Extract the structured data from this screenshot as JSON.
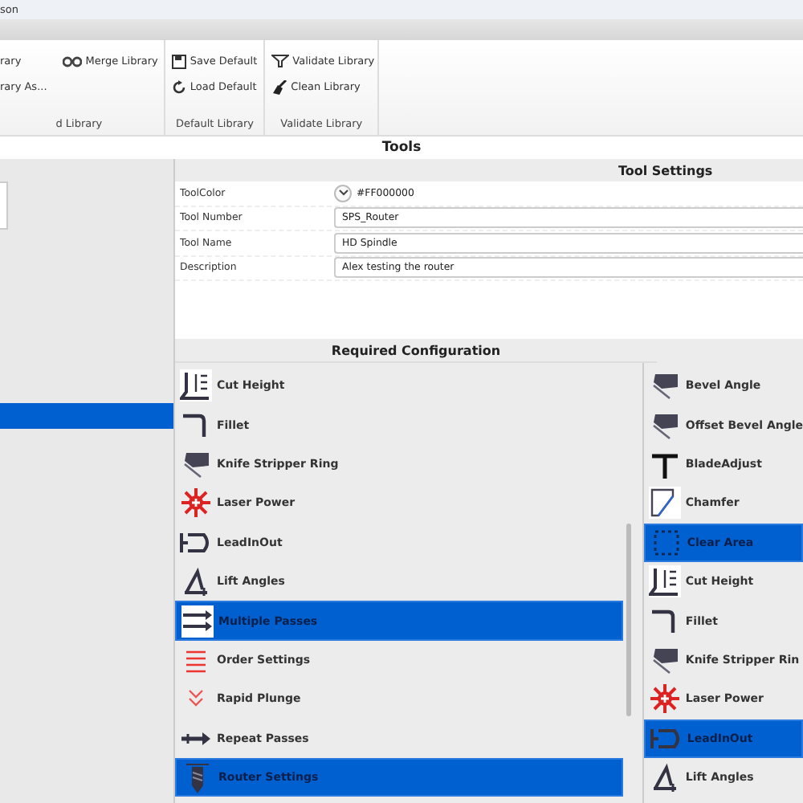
{
  "window": {
    "title": "son"
  },
  "ribbon": {
    "groups": [
      {
        "label": "d Library",
        "buttons": [
          {
            "label": "rary",
            "kind": "none"
          },
          {
            "label": "rary As...",
            "kind": "none"
          },
          {
            "label": "Merge Library",
            "kind": "merge"
          }
        ]
      },
      {
        "label": "Default Library",
        "buttons": [
          {
            "label": "Save Default",
            "kind": "save"
          },
          {
            "label": "Load Default",
            "kind": "load"
          }
        ]
      },
      {
        "label": "Validate Library",
        "buttons": [
          {
            "label": "Validate Library",
            "kind": "validate"
          },
          {
            "label": "Clean Library",
            "kind": "clean"
          }
        ]
      }
    ]
  },
  "tools": {
    "title": "Tools"
  },
  "tool_settings": {
    "title": "Tool Settings",
    "properties": [
      {
        "label": "ToolColor",
        "value": "#FF000000",
        "kind": "color"
      },
      {
        "label": "Tool Number",
        "value": "SPS_Router",
        "kind": "text"
      },
      {
        "label": "Tool Name",
        "value": "HD Spindle",
        "kind": "text"
      },
      {
        "label": "Description",
        "value": "Alex testing the router",
        "kind": "text"
      }
    ]
  },
  "required_configuration": {
    "title": "Required Configuration",
    "list_1": [
      {
        "label": "Cut Height",
        "kind": "height",
        "selected": false
      },
      {
        "label": "Fillet",
        "kind": "fillet",
        "selected": false
      },
      {
        "label": "Knife Stripper Ring",
        "kind": "knife",
        "selected": false
      },
      {
        "label": "Laser Power",
        "kind": "laser",
        "selected": false
      },
      {
        "label": "LeadInOut",
        "kind": "lead",
        "selected": false
      },
      {
        "label": "Lift Angles",
        "kind": "lift",
        "selected": false
      },
      {
        "label": "Multiple Passes",
        "kind": "passes",
        "selected": true
      },
      {
        "label": "Order Settings",
        "kind": "order",
        "selected": false
      },
      {
        "label": "Rapid Plunge",
        "kind": "plunge",
        "selected": false
      },
      {
        "label": "Repeat Passes",
        "kind": "repeat",
        "selected": false
      },
      {
        "label": "Router Settings",
        "kind": "router",
        "selected": true
      }
    ],
    "list_2": [
      {
        "label": "Bevel Angle",
        "kind": "knife",
        "selected": false
      },
      {
        "label": "Offset Bevel Angle",
        "kind": "knife",
        "selected": false
      },
      {
        "label": "BladeAdjust",
        "kind": "blade",
        "selected": false
      },
      {
        "label": "Chamfer",
        "kind": "chamfer",
        "selected": false
      },
      {
        "label": "Clear Area",
        "kind": "clear",
        "selected": true
      },
      {
        "label": "Cut Height",
        "kind": "height",
        "selected": false
      },
      {
        "label": "Fillet",
        "kind": "fillet",
        "selected": false
      },
      {
        "label": "Knife Stripper Rin",
        "kind": "knife",
        "selected": false
      },
      {
        "label": "Laser Power",
        "kind": "laser",
        "selected": false
      },
      {
        "label": "LeadInOut",
        "kind": "lead",
        "selected": true
      },
      {
        "label": "Lift Angles",
        "kind": "lift",
        "selected": false
      }
    ]
  }
}
